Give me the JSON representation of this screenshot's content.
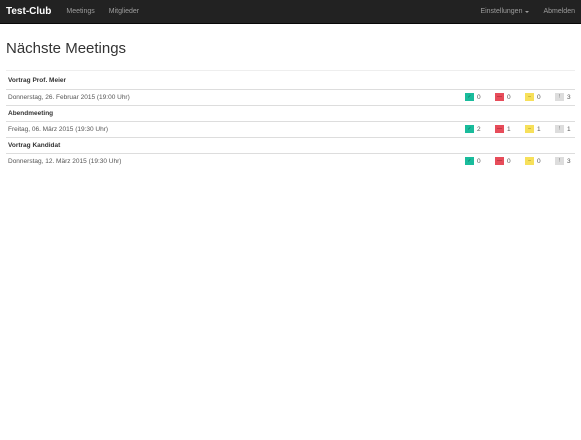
{
  "nav": {
    "brand": "Test-Club",
    "links": [
      "Meetings",
      "Mitglieder"
    ],
    "settings": "Einstellungen",
    "logout": "Abmelden"
  },
  "page_title": "Nächste Meetings",
  "meetings": [
    {
      "title": "Vortrag Prof. Meier",
      "date": "Donnerstag, 26. Februar 2015 (19:00 Uhr)",
      "yes": "0",
      "no": "0",
      "maybe": "0",
      "none": "3"
    },
    {
      "title": "Abendmeeting",
      "date": "Freitag, 06. März 2015 (19:30 Uhr)",
      "yes": "2",
      "no": "1",
      "maybe": "1",
      "none": "1"
    },
    {
      "title": "Vortrag Kandidat",
      "date": "Donnerstag, 12. März 2015 (19:30 Uhr)",
      "yes": "0",
      "no": "0",
      "maybe": "0",
      "none": "3"
    }
  ],
  "icons": {
    "yes": "check-icon",
    "no": "minus-icon",
    "maybe": "dash-icon",
    "none": "exclamation-icon"
  },
  "colors": {
    "navbar": "#222222",
    "yes": "#1abc9c",
    "no": "#e74c5a",
    "maybe": "#f7e05a",
    "none": "#dddddd"
  }
}
